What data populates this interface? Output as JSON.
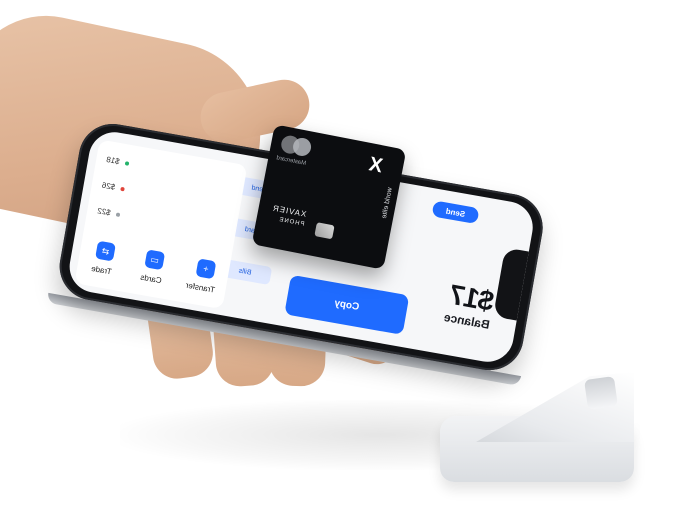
{
  "scene": {
    "description_free": true
  },
  "phone": {
    "balance_label": "Balance",
    "balance_value": "$17",
    "top_pill": "Send",
    "cta_label": "Copy",
    "chips": [
      "Send",
      "Card",
      "Bills"
    ],
    "list": [
      {
        "text": "$18",
        "dot_color": "#24b36b"
      },
      {
        "text": "$26",
        "dot_color": "#e0443a"
      },
      {
        "text": "$22",
        "dot_color": "#9aa0a6"
      }
    ],
    "nav": [
      {
        "icon": "plus-icon",
        "label": "Transfer"
      },
      {
        "icon": "card-icon",
        "label": "Cards"
      },
      {
        "icon": "arrows-icon",
        "label": "Trade"
      }
    ],
    "accent_color": "#1f6bff"
  },
  "card": {
    "logo_glyph": "X",
    "world_text": "world elite",
    "holder": "XAVIER",
    "sub_holder": "PHONE",
    "brand": "Mastercard",
    "color": "#0c0d10"
  },
  "dock": {
    "color": "#eceef1"
  }
}
